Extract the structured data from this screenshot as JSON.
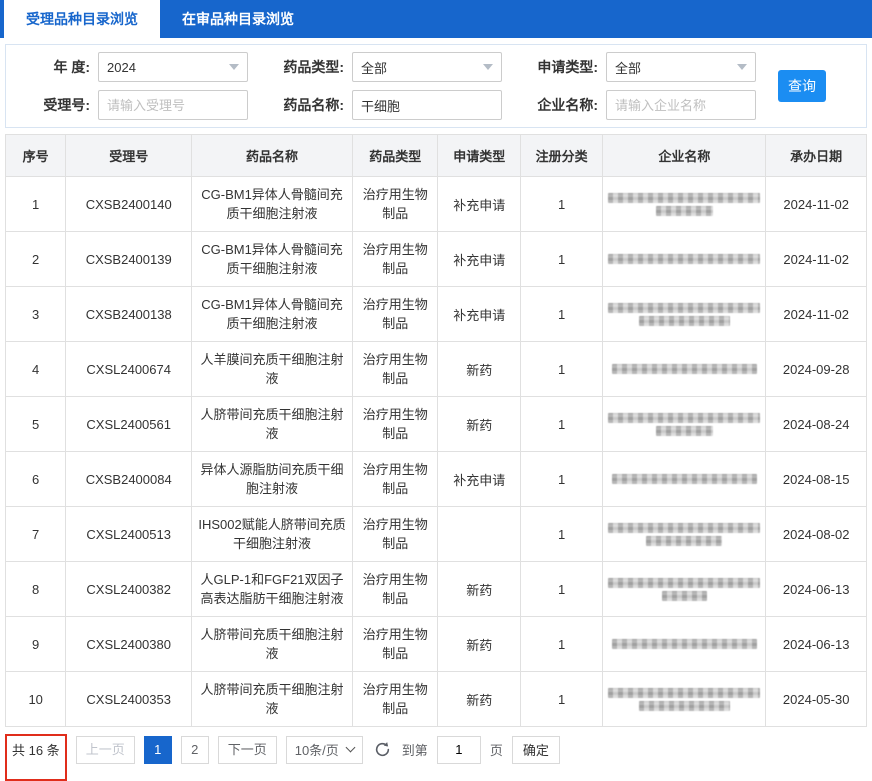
{
  "colors": {
    "primary": "#1766cc",
    "search_button": "#1b8df2",
    "annotation": "#e02d1b"
  },
  "tabs": [
    {
      "label": "受理品种目录浏览",
      "active": true
    },
    {
      "label": "在审品种目录浏览",
      "active": false
    }
  ],
  "filters": {
    "year_label": "年 度:",
    "year_value": "2024",
    "drug_type_label": "药品类型:",
    "drug_type_value": "全部",
    "apply_type_label": "申请类型:",
    "apply_type_value": "全部",
    "accept_no_label": "受理号:",
    "accept_no_placeholder": "请输入受理号",
    "accept_no_value": "",
    "drug_name_label": "药品名称:",
    "drug_name_value": "干细胞",
    "enterprise_label": "企业名称:",
    "enterprise_placeholder": "请输入企业名称",
    "enterprise_value": "",
    "search_button": "查询"
  },
  "table": {
    "headers": [
      "序号",
      "受理号",
      "药品名称",
      "药品类型",
      "申请类型",
      "注册分类",
      "企业名称",
      "承办日期"
    ],
    "rows": [
      {
        "no": "1",
        "accept_no": "CXSB2400140",
        "drug_name": "CG-BM1异体人骨髓间充质干细胞注射液",
        "drug_type": "治疗用生物制品",
        "apply_type": "补充申请",
        "reg_class": "1",
        "enterprise_redacted": true,
        "enterprise_lines": [
          1,
          0.38
        ],
        "date": "2024-11-02"
      },
      {
        "no": "2",
        "accept_no": "CXSB2400139",
        "drug_name": "CG-BM1异体人骨髓间充质干细胞注射液",
        "drug_type": "治疗用生物制品",
        "apply_type": "补充申请",
        "reg_class": "1",
        "enterprise_redacted": true,
        "enterprise_lines": [
          1
        ],
        "date": "2024-11-02"
      },
      {
        "no": "3",
        "accept_no": "CXSB2400138",
        "drug_name": "CG-BM1异体人骨髓间充质干细胞注射液",
        "drug_type": "治疗用生物制品",
        "apply_type": "补充申请",
        "reg_class": "1",
        "enterprise_redacted": true,
        "enterprise_lines": [
          1,
          0.6
        ],
        "date": "2024-11-02"
      },
      {
        "no": "4",
        "accept_no": "CXSL2400674",
        "drug_name": "人羊膜间充质干细胞注射液",
        "drug_type": "治疗用生物制品",
        "apply_type": "新药",
        "reg_class": "1",
        "enterprise_redacted": true,
        "enterprise_lines": [
          0.95
        ],
        "date": "2024-09-28"
      },
      {
        "no": "5",
        "accept_no": "CXSL2400561",
        "drug_name": "人脐带间充质干细胞注射液",
        "drug_type": "治疗用生物制品",
        "apply_type": "新药",
        "reg_class": "1",
        "enterprise_redacted": true,
        "enterprise_lines": [
          1,
          0.38
        ],
        "date": "2024-08-24"
      },
      {
        "no": "6",
        "accept_no": "CXSB2400084",
        "drug_name": "异体人源脂肪间充质干细胞注射液",
        "drug_type": "治疗用生物制品",
        "apply_type": "补充申请",
        "reg_class": "1",
        "enterprise_redacted": true,
        "enterprise_lines": [
          0.95
        ],
        "date": "2024-08-15"
      },
      {
        "no": "7",
        "accept_no": "CXSL2400513",
        "drug_name": "IHS002赋能人脐带间充质干细胞注射液",
        "drug_type": "治疗用生物制品",
        "apply_type": "",
        "reg_class": "1",
        "enterprise_redacted": true,
        "enterprise_lines": [
          1,
          0.5
        ],
        "date": "2024-08-02"
      },
      {
        "no": "8",
        "accept_no": "CXSL2400382",
        "drug_name": "人GLP-1和FGF21双因子高表达脂肪干细胞注射液",
        "drug_type": "治疗用生物制品",
        "apply_type": "新药",
        "reg_class": "1",
        "enterprise_redacted": true,
        "enterprise_lines": [
          1,
          0.3
        ],
        "date": "2024-06-13"
      },
      {
        "no": "9",
        "accept_no": "CXSL2400380",
        "drug_name": "人脐带间充质干细胞注射液",
        "drug_type": "治疗用生物制品",
        "apply_type": "新药",
        "reg_class": "1",
        "enterprise_redacted": true,
        "enterprise_lines": [
          0.95
        ],
        "date": "2024-06-13"
      },
      {
        "no": "10",
        "accept_no": "CXSL2400353",
        "drug_name": "人脐带间充质干细胞注射液",
        "drug_type": "治疗用生物制品",
        "apply_type": "新药",
        "reg_class": "1",
        "enterprise_redacted": true,
        "enterprise_lines": [
          1,
          0.6
        ],
        "date": "2024-05-30"
      }
    ]
  },
  "pagination": {
    "total": "共 16 条",
    "prev": "上一页",
    "pages": [
      "1",
      "2"
    ],
    "active_page": "1",
    "next": "下一页",
    "page_size": "10条/页",
    "goto_label": "到第",
    "goto_value": "1",
    "goto_unit": "页",
    "confirm": "确定"
  }
}
